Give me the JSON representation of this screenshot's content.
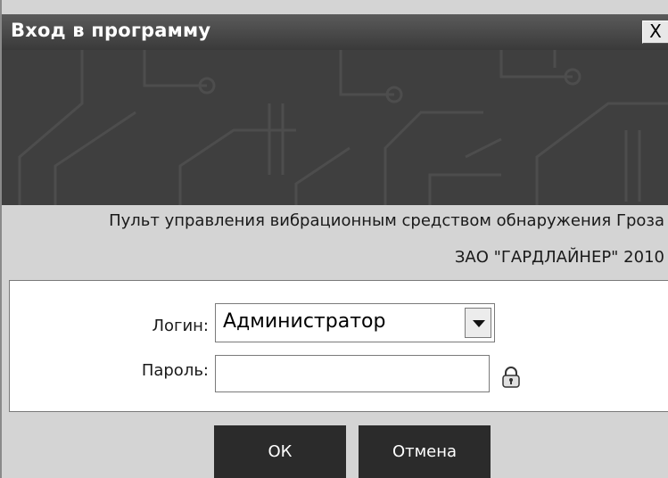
{
  "window": {
    "title": "Вход в программу",
    "close_label": "X"
  },
  "info": {
    "line1": "Пульт управления вибрационным средством обнаружения Гроза",
    "line2": "ЗАО \"ГАРДЛАЙНЕР\" 2010"
  },
  "form": {
    "login_label": "Логин:",
    "login_value": "Администратор",
    "password_label": "Пароль:",
    "password_value": ""
  },
  "buttons": {
    "ok_label": "ОК",
    "cancel_label": "Отмена"
  },
  "colors": {
    "titlebar": "#4a4a4a",
    "banner": "#3f3f3f",
    "dialog_bg": "#d4d4d4",
    "button_bg": "#2b2b2b"
  },
  "icons": {
    "close": "close-icon",
    "dropdown": "chevron-down-icon",
    "lock": "lock-icon"
  }
}
